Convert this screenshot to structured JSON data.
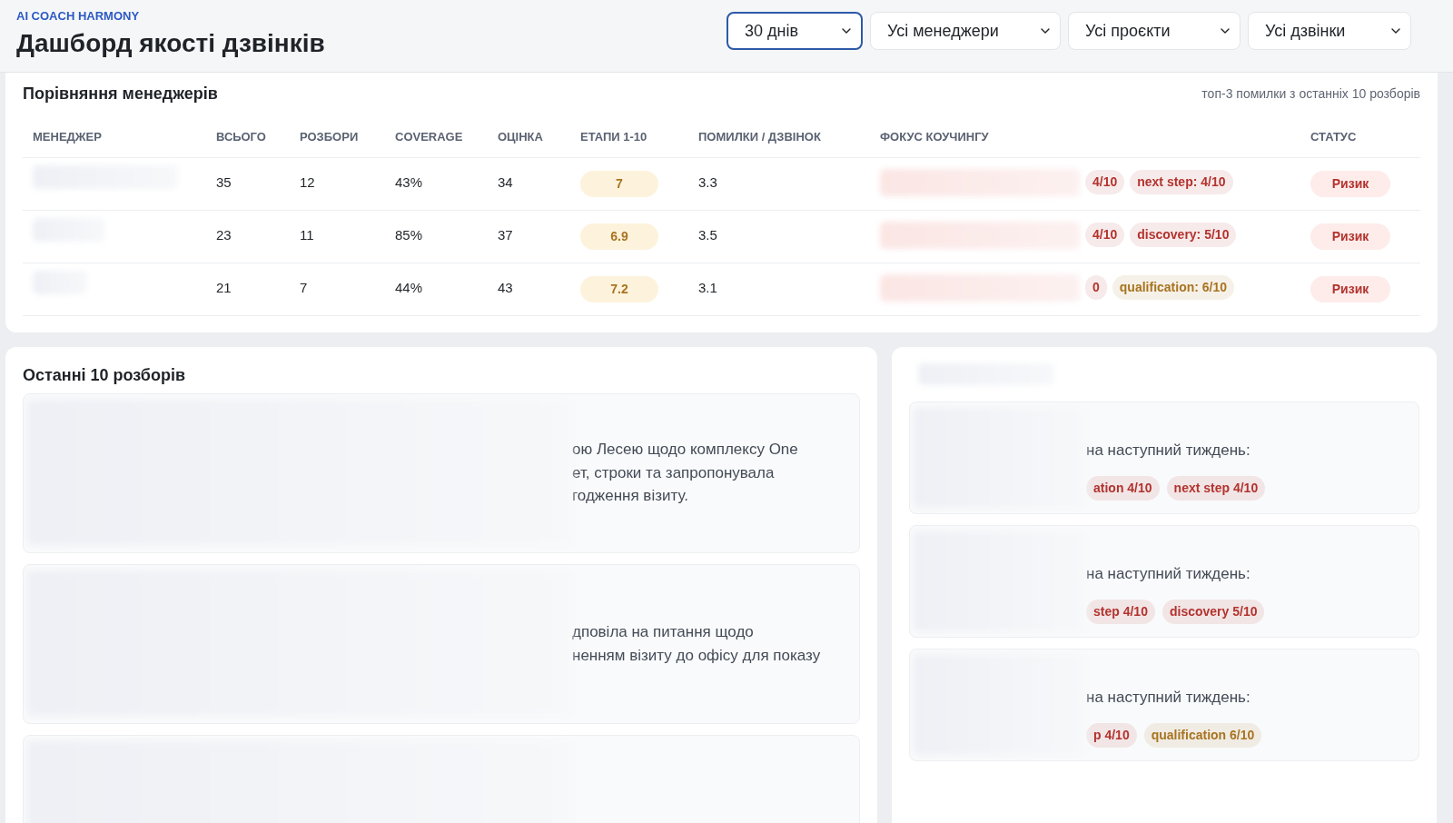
{
  "header": {
    "brand": "AI COACH HARMONY",
    "title": "Дашборд якості дзвінків"
  },
  "filters": [
    {
      "label": "30 днів",
      "selected": true
    },
    {
      "label": "Усі менеджери",
      "selected": false
    },
    {
      "label": "Усі проєкти",
      "selected": false
    },
    {
      "label": "Усі дзвінки",
      "selected": false
    }
  ],
  "comparison": {
    "title": "Порівняння менеджерів",
    "note": "топ-3 помилки з останніх 10 розборів",
    "columns": [
      "МЕНЕДЖЕР",
      "ВСЬОГО",
      "РОЗБОРИ",
      "COVERAGE",
      "ОЦІНКА",
      "ЕТАПИ 1-10",
      "ПОМИЛКИ / ДЗВІНОК",
      "ФОКУС КОУЧИНГУ",
      "СТАТУС"
    ],
    "rows": [
      {
        "total": "35",
        "reviews": "12",
        "coverage": "43%",
        "score": "34",
        "stages": "7",
        "errors": "3.3",
        "focus": [
          {
            "label": "4/10",
            "color": "#b3332e"
          },
          {
            "label": "next step: 4/10",
            "color": "#b3332e"
          }
        ],
        "status": "Ризик"
      },
      {
        "total": "23",
        "reviews": "11",
        "coverage": "85%",
        "score": "37",
        "stages": "6.9",
        "errors": "3.5",
        "focus": [
          {
            "label": "4/10",
            "color": "#b3332e"
          },
          {
            "label": "discovery: 5/10",
            "color": "#b3332e"
          }
        ],
        "status": "Ризик"
      },
      {
        "total": "21",
        "reviews": "7",
        "coverage": "44%",
        "score": "43",
        "stages": "7.2",
        "errors": "3.1",
        "focus": [
          {
            "label": "0",
            "color": "#b3332e"
          },
          {
            "label": "qualification: 6/10",
            "color": "#a87421"
          }
        ],
        "status": "Ризик"
      }
    ]
  },
  "recent": {
    "title": "Останні 10 розборів",
    "items": [
      {
        "lines": [
          "ою Лесею щодо комплексу One",
          "ет, строки та запропонувала",
          "годження візиту."
        ]
      },
      {
        "lines": [
          "дповіла на питання щодо",
          "ненням візиту до офісу для показу"
        ]
      }
    ]
  },
  "coaching": {
    "items": [
      {
        "text": "на наступний тиждень:",
        "tags": [
          {
            "label": "ation 4/10",
            "color": "#b3332e"
          },
          {
            "label": "next step 4/10",
            "color": "#b3332e"
          }
        ]
      },
      {
        "text": "на наступний тиждень:",
        "tags": [
          {
            "label": "step 4/10",
            "color": "#b3332e"
          },
          {
            "label": "discovery 5/10",
            "color": "#b3332e"
          }
        ]
      },
      {
        "text": "на наступний тиждень:",
        "tags": [
          {
            "label": "p 4/10",
            "color": "#b3332e"
          },
          {
            "label": "qualification 6/10",
            "color": "#a87421"
          }
        ]
      }
    ]
  }
}
